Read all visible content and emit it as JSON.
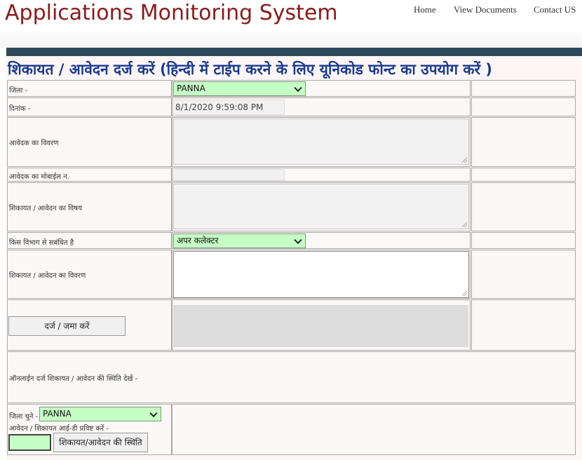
{
  "header": {
    "app_title": "Applications Monitoring System",
    "nav": [
      "Home",
      "View Documents",
      "Contact US"
    ]
  },
  "colors": {
    "title": "#8b1a1a",
    "heading": "#1a3a8f",
    "bar": "#2e4a5c",
    "select_bg": "#c6ffc6"
  },
  "form": {
    "heading": "शिकायत / आवेदन दर्ज करें (हिन्दी में टाईप करने के लिए यूनिकोड फोन्ट का उपयोग करें )",
    "district_label": "जिला -",
    "district_value": "PANNA",
    "date_label": "दिनांक -",
    "date_value": "8/1/2020 9:59:08 PM",
    "applicant_details_label": "आवेदक का विवरण",
    "mobile_label": "आवेदक का मोबाईल न.",
    "subject_label": "शिकायत / आवेदन का विषय",
    "department_label": "किस विभाग से सबंधित है",
    "department_value": "अपर कलेक्टर",
    "complaint_details_label": "शिकायत / आवेदन का विवरण",
    "submit_label": "दर्ज / जमा करें"
  },
  "status": {
    "section_label": "ऑनलाईन दर्ज शिकायत / आवेदन की स्थिति देखें -",
    "district_label": "जिला चुने -",
    "district_value": "PANNA",
    "id_label": "आवेदन / शिकायत आई-डी प्रविष्ट करें -",
    "check_button": "शिकायत/आवेदन की स्थिति"
  }
}
